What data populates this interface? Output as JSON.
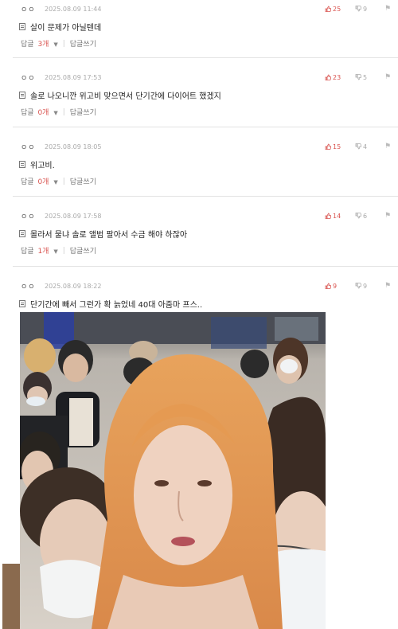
{
  "comments": [
    {
      "nick": "ㅇㅇ",
      "date": "2025.08.09 11:44",
      "up": "25",
      "down": "9",
      "text": "살이 문제가 아닐텐데",
      "reply_label": "답글",
      "reply_count": "3개",
      "write_reply": "답글쓰기"
    },
    {
      "nick": "ㅇㅇ",
      "date": "2025.08.09 17:53",
      "up": "23",
      "down": "5",
      "text": "솔로 나오니깐 위고비 맞으면서 단기간에 다이어트 했겠지",
      "reply_label": "답글",
      "reply_count": "0개",
      "write_reply": "답글쓰기"
    },
    {
      "nick": "ㅇㅇ",
      "date": "2025.08.09 18:05",
      "up": "15",
      "down": "4",
      "text": "위고비.",
      "reply_label": "답글",
      "reply_count": "0개",
      "write_reply": "답글쓰기"
    },
    {
      "nick": "ㅇㅇ",
      "date": "2025.08.09 17:58",
      "up": "14",
      "down": "6",
      "text": "몰라서 물냐 솔로 앨범 팔아서 수금 해야 하잖아",
      "reply_label": "답글",
      "reply_count": "1개",
      "write_reply": "답글쓰기"
    },
    {
      "nick": "ㅇㅇ",
      "date": "2025.08.09 18:22",
      "up": "9",
      "down": "9",
      "text": "단기간에 빼서 그런가 확 늙었네 40대 아줌마 프스.."
    }
  ],
  "icons": {
    "upvote": "thumb-up-icon",
    "downvote": "thumb-down-icon",
    "report": "person-icon",
    "chevron": "chevron-down-icon",
    "attachment": "document-icon"
  },
  "colors": {
    "upvote": "#d9534f",
    "reply_count": "#d9534f",
    "muted": "#aaaaaa"
  }
}
